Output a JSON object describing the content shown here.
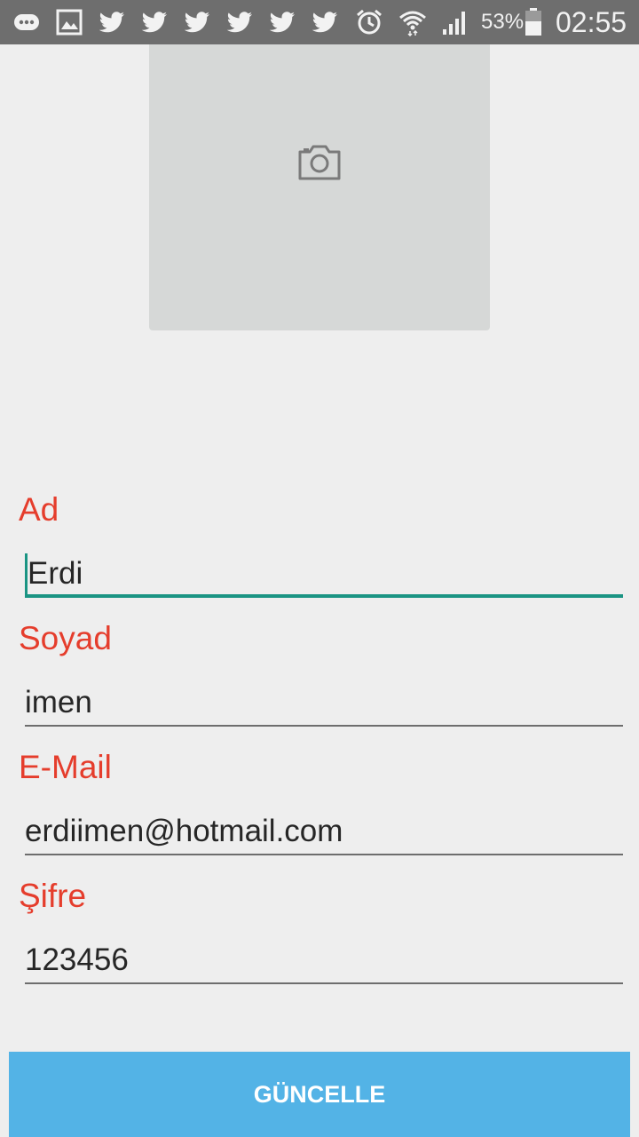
{
  "status_bar": {
    "icons": [
      "message-icon",
      "gallery-icon",
      "twitter-icon",
      "twitter-icon",
      "twitter-icon",
      "twitter-icon",
      "twitter-icon",
      "twitter-icon",
      "alarm-icon",
      "wifi-icon",
      "signal-icon",
      "battery-icon"
    ],
    "battery_percent": "53%",
    "time": "02:55"
  },
  "photo": {
    "icon": "camera-icon"
  },
  "form": {
    "name_label": "Ad",
    "name_value": "Erdi",
    "surname_label": "Soyad",
    "surname_value": "imen",
    "email_label": "E-Mail",
    "email_value": "erdiimen@hotmail.com",
    "password_label": "Şifre",
    "password_value": "123456"
  },
  "update_button": "GÜNCELLE",
  "colors": {
    "status_bar": "#6e6e6e",
    "label": "#e53d2c",
    "accent": "#1a9483",
    "button": "#53b3e6",
    "placeholder_bg": "#d6d8d7"
  }
}
